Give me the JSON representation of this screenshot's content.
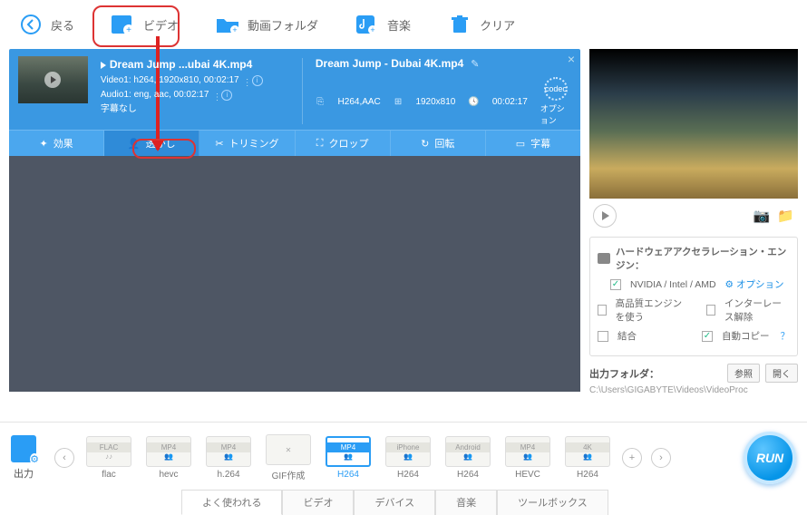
{
  "topbar": {
    "back": "戻る",
    "video": "ビデオ",
    "folder": "動画フォルダ",
    "music": "音楽",
    "clear": "クリア"
  },
  "file": {
    "src_name": "Dream Jump ...ubai 4K.mp4",
    "video_line": "Video1: h264, 1920x810, 00:02:17",
    "audio_line": "Audio1: eng, aac, 00:02:17",
    "subtitle_line": "字幕なし",
    "out_name": "Dream Jump - Dubai 4K.mp4",
    "out_codec": "H264,AAC",
    "out_res": "1920x810",
    "out_dur": "00:02:17",
    "codec_label": "オプション",
    "codec_inner": "codec"
  },
  "tabs": {
    "effect": "効果",
    "watermark": "透かし",
    "trim": "トリミング",
    "crop": "クロップ",
    "rotate": "回転",
    "subtitle": "字幕"
  },
  "hw": {
    "title": "ハードウェアアクセラレーション・エンジン：",
    "gpu": "NVIDIA / Intel / AMD",
    "option": "オプション",
    "hq": "高品質エンジンを使う",
    "deint": "インターレース解除",
    "merge": "結合",
    "autocopy": "自動コピー",
    "q": "？"
  },
  "outfolder": {
    "label": "出力フォルダ：",
    "browse": "参照",
    "open": "開く",
    "path": "C:\\Users\\GIGABYTE\\Videos\\VideoProc"
  },
  "output": {
    "label": "出力",
    "gif": "GIF作成",
    "formats": [
      {
        "top": "FLAC",
        "sub": "flac"
      },
      {
        "top": "MP4",
        "sub": "hevc"
      },
      {
        "top": "MP4",
        "sub": "h.264"
      },
      {
        "top": "",
        "sub": "GIF作成"
      },
      {
        "top": "MP4",
        "sub": "H264"
      },
      {
        "top": "iPhone",
        "sub": "H264"
      },
      {
        "top": "Android",
        "sub": "H264"
      },
      {
        "top": "MP4",
        "sub": "HEVC"
      },
      {
        "top": "4K",
        "sub": "H264"
      }
    ]
  },
  "cats": {
    "popular": "よく使われる",
    "video": "ビデオ",
    "device": "デバイス",
    "music": "音楽",
    "toolbox": "ツールボックス"
  },
  "run": "RUN"
}
